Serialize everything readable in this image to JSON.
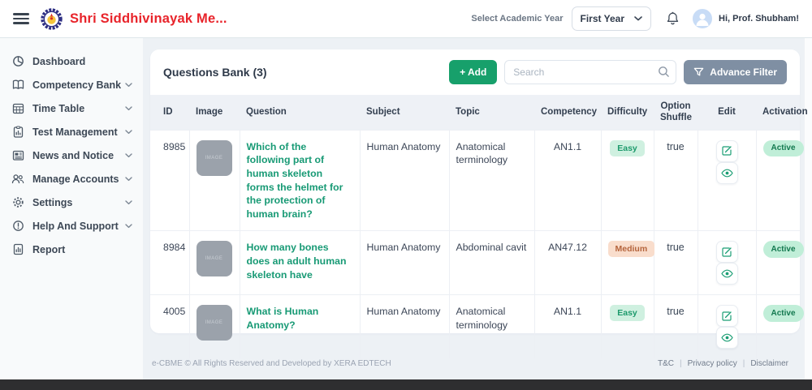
{
  "header": {
    "brand": "Shri Siddhivinayak Me...",
    "academic_year_label": "Select Academic Year",
    "academic_year_value": "First Year",
    "greeting": "Hi, Prof. Shubham!"
  },
  "sidebar": {
    "items": [
      {
        "label": "Dashboard",
        "icon": "dashboard-icon",
        "expandable": false
      },
      {
        "label": "Competency Bank",
        "icon": "book-icon",
        "expandable": true
      },
      {
        "label": "Time Table",
        "icon": "calendar-icon",
        "expandable": true
      },
      {
        "label": "Test Management",
        "icon": "clipboard-chart-icon",
        "expandable": true
      },
      {
        "label": "News and Notice",
        "icon": "newspaper-icon",
        "expandable": true
      },
      {
        "label": "Manage Accounts",
        "icon": "users-icon",
        "expandable": true
      },
      {
        "label": "Settings",
        "icon": "gear-icon",
        "expandable": true
      },
      {
        "label": "Help And Support",
        "icon": "help-circle-icon",
        "expandable": true
      },
      {
        "label": "Report",
        "icon": "report-icon",
        "expandable": false
      }
    ]
  },
  "main": {
    "title": "Questions Bank (3)",
    "add_button": "+ Add",
    "search": {
      "placeholder": "Search"
    },
    "advance_filter": "Advance Filter",
    "table": {
      "columns": [
        "ID",
        "Image",
        "Question",
        "Subject",
        "Topic",
        "Competency",
        "Difficulty",
        "Option Shuffle",
        "Edit",
        "Activation"
      ],
      "rows": [
        {
          "id": "8985",
          "image_placeholder": "IMAGE",
          "question": "Which of the following part of human skeleton forms the helmet for the protection of human brain?",
          "subject": "Human Anatomy",
          "topic": "Anatomical terminology",
          "competency": "AN1.1",
          "difficulty": "Easy",
          "option_shuffle": "true",
          "activation": "Active"
        },
        {
          "id": "8984",
          "image_placeholder": "IMAGE",
          "question": "How many bones does an adult human skeleton have",
          "subject": "Human Anatomy",
          "topic": "Abdominal cavit",
          "competency": "AN47.12",
          "difficulty": "Medium",
          "option_shuffle": "true",
          "activation": "Active"
        },
        {
          "id": "4005",
          "image_placeholder": "IMAGE",
          "question": "What is Human Anatomy?",
          "subject": "Human Anatomy",
          "topic": "Anatomical terminology",
          "competency": "AN1.1",
          "difficulty": "Easy",
          "option_shuffle": "true",
          "activation": "Active"
        }
      ]
    }
  },
  "footer": {
    "copyright": "e-CBME © All Rights Reserved and Developed by XERA EDTECH",
    "links": [
      "T&C",
      "Privacy policy",
      "Disclaimer"
    ]
  },
  "icons": {
    "hamburger": "☰",
    "search": "magnifier",
    "advance_filter": "funnel",
    "notification": "bell",
    "edit": "pencil-square",
    "view": "eye",
    "expand": "chevron-down"
  },
  "colors": {
    "brand_red": "#e8232a",
    "accent_green": "#17a06b",
    "question_green": "#189a75",
    "slate_button": "#7f8fa3",
    "easy_badge_bg": "#cff0e0",
    "easy_badge_text": "#1d9a6c",
    "medium_badge_bg": "#f9ddcc",
    "medium_badge_text": "#b5643c",
    "active_badge_bg": "#c0eed8",
    "active_badge_text": "#13794f"
  }
}
